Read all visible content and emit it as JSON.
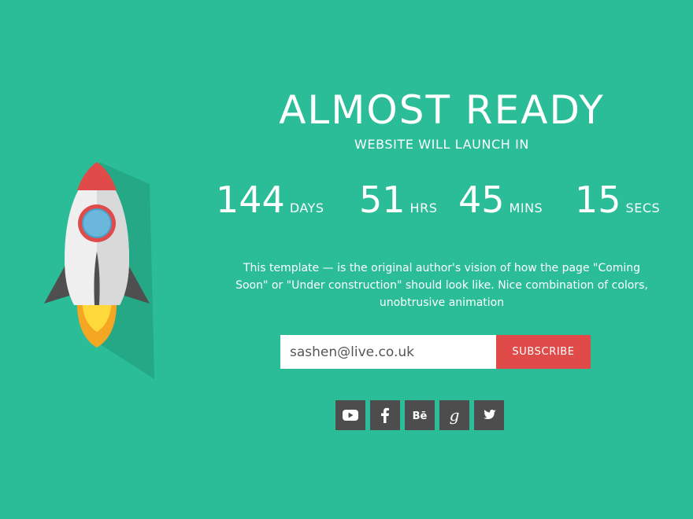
{
  "hero": {
    "title": "ALMOST READY",
    "subtitle": "WEBSITE WILL LAUNCH IN"
  },
  "countdown": [
    {
      "value": "144",
      "unit": "DAYS"
    },
    {
      "value": "51",
      "unit": "HRS"
    },
    {
      "value": "45",
      "unit": "MINS"
    },
    {
      "value": "15",
      "unit": "SECS"
    }
  ],
  "description": "This template — is the original author's vision of how the page \"Coming Soon\" or \"Under construction\" should look like. Nice combination of colors, unobtrusive animation",
  "subscribe": {
    "email_value": "sashen@live.co.uk",
    "button_label": "SUBSCRIBE"
  },
  "social": [
    {
      "icon": "youtube-icon"
    },
    {
      "icon": "facebook-icon"
    },
    {
      "icon": "behance-icon",
      "glyph": "Bē"
    },
    {
      "icon": "google-icon",
      "glyph": "g"
    },
    {
      "icon": "twitter-icon"
    }
  ],
  "colors": {
    "background": "#2abd98",
    "accent_red": "#e04b4a",
    "social_bg": "#4d4d4d"
  }
}
